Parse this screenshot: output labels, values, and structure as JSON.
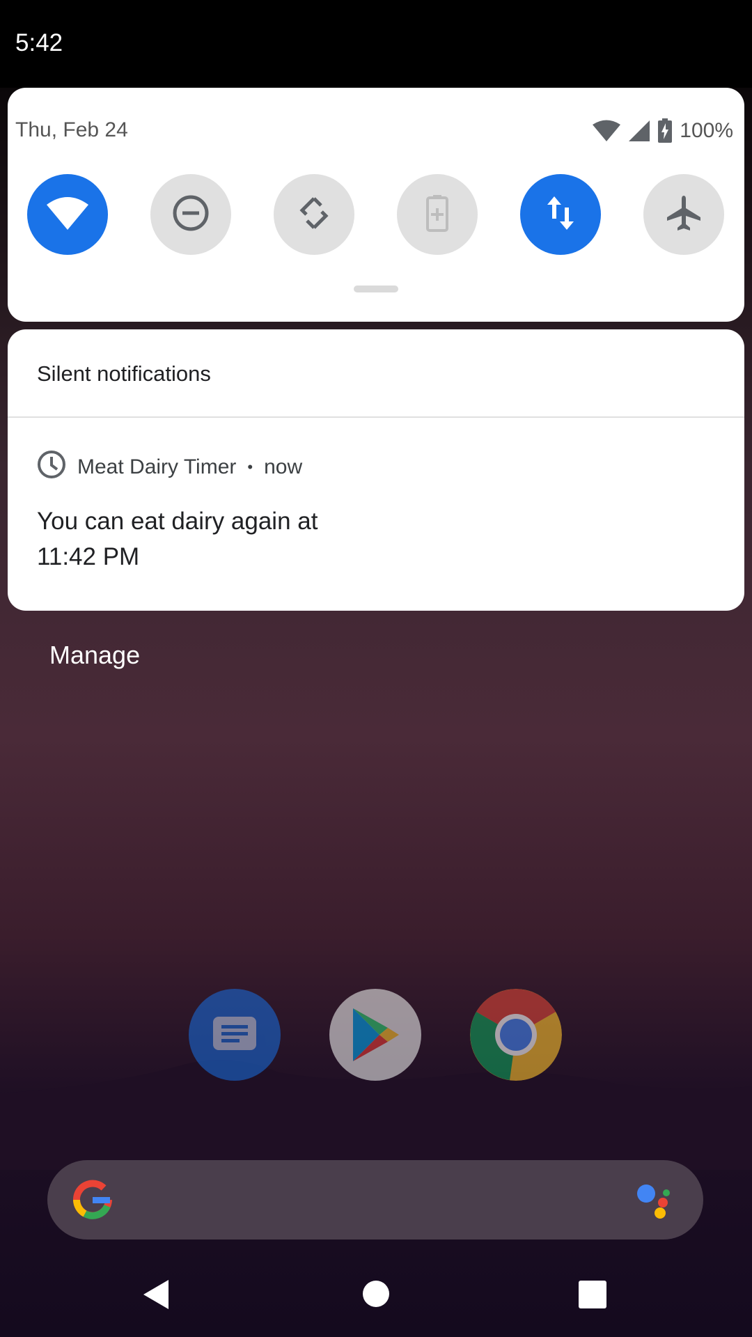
{
  "status_bar": {
    "time": "5:42"
  },
  "quick_settings": {
    "date": "Thu, Feb 24",
    "battery_percent": "100%",
    "tiles": [
      {
        "name": "wifi",
        "icon": "wifi-icon",
        "state": "on"
      },
      {
        "name": "do-not-disturb",
        "icon": "do-not-disturb-icon",
        "state": "off"
      },
      {
        "name": "auto-rotate",
        "icon": "auto-rotate-icon",
        "state": "off"
      },
      {
        "name": "battery-saver",
        "icon": "battery-saver-icon",
        "state": "disabled"
      },
      {
        "name": "mobile-data",
        "icon": "mobile-data-icon",
        "state": "on"
      },
      {
        "name": "airplane-mode",
        "icon": "airplane-icon",
        "state": "off"
      }
    ],
    "accent": "#1a73e8"
  },
  "notifications": {
    "section_title": "Silent notifications",
    "items": [
      {
        "app": "Meat Dairy Timer",
        "separator": "•",
        "time": "now",
        "icon": "clock-icon",
        "line1": "You can eat dairy again at",
        "line2": "11:42 PM"
      }
    ],
    "manage_label": "Manage"
  },
  "dock": {
    "apps": [
      "messages-icon",
      "play-store-icon",
      "chrome-icon"
    ]
  },
  "search": {
    "left_icon": "google-g-icon",
    "right_icon": "assistant-icon"
  },
  "nav": {
    "buttons": [
      "back-icon",
      "home-icon",
      "recents-icon"
    ]
  }
}
